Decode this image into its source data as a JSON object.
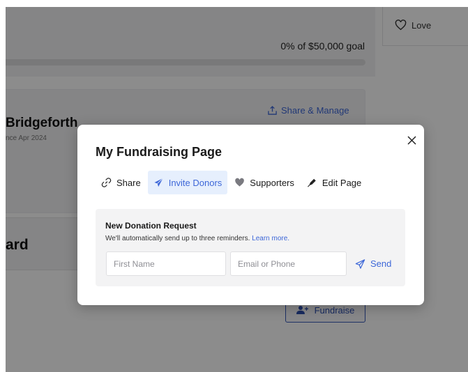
{
  "background": {
    "goal_text": "0% of $50,000 goal",
    "love_label": "Love",
    "share_manage_label": "Share & Manage",
    "org_name": "Bridgeforth",
    "org_since": "nce Apr 2024",
    "board_title": "ard",
    "fundraise_label": "Fundraise"
  },
  "modal": {
    "title": "My Fundraising Page",
    "tabs": [
      {
        "label": "Share",
        "icon": "link-icon",
        "active": false
      },
      {
        "label": "Invite Donors",
        "icon": "paper-plane-icon",
        "active": true
      },
      {
        "label": "Supporters",
        "icon": "heart-icon",
        "active": false
      },
      {
        "label": "Edit Page",
        "icon": "pen-icon",
        "active": false
      }
    ],
    "request": {
      "title": "New Donation Request",
      "subtitle": "We'll automatically send up to three reminders.",
      "learn_more": "Learn more.",
      "first_name_placeholder": "First Name",
      "email_placeholder": "Email or Phone",
      "send_label": "Send"
    }
  },
  "colors": {
    "accent": "#3d67d8",
    "active_tab_bg": "#e6effd",
    "overlay": "rgba(0,0,0,0.45)"
  }
}
